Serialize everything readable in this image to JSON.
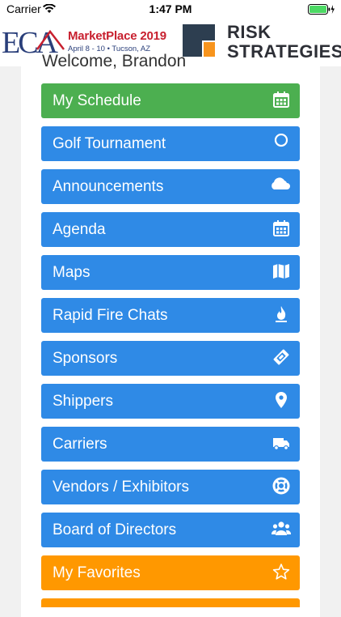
{
  "statusbar": {
    "carrier": "Carrier",
    "time": "1:47 PM"
  },
  "banner": {
    "eca_letters": "ECA",
    "event_title": "MarketPlace 2019",
    "event_subtitle": "April 8 - 10  •  Tucson, AZ",
    "sponsor_line1": "RISK",
    "sponsor_line2": "STRATEGIES"
  },
  "welcome": "Welcome, Brandon",
  "colors": {
    "green": "#4caf50",
    "blue": "#2f8ae6",
    "orange": "#ff9800"
  },
  "menu": [
    {
      "label": "My Schedule",
      "icon": "calendar-check-icon",
      "color": "green"
    },
    {
      "label": "Golf Tournament",
      "icon": "circle-icon",
      "color": "blue"
    },
    {
      "label": "Announcements",
      "icon": "cloud-icon",
      "color": "blue"
    },
    {
      "label": "Agenda",
      "icon": "calendar-icon",
      "color": "blue"
    },
    {
      "label": "Maps",
      "icon": "map-icon",
      "color": "blue"
    },
    {
      "label": "Rapid Fire Chats",
      "icon": "fire-icon",
      "color": "blue"
    },
    {
      "label": "Sponsors",
      "icon": "ticket-icon",
      "color": "blue"
    },
    {
      "label": "Shippers",
      "icon": "map-marker-icon",
      "color": "blue"
    },
    {
      "label": "Carriers",
      "icon": "truck-icon",
      "color": "blue"
    },
    {
      "label": "Vendors / Exhibitors",
      "icon": "life-ring-icon",
      "color": "blue"
    },
    {
      "label": "Board of Directors",
      "icon": "users-icon",
      "color": "blue"
    },
    {
      "label": "My Favorites",
      "icon": "star-icon",
      "color": "orange"
    },
    {
      "label": "",
      "icon": "gear-icon",
      "color": "orange"
    }
  ]
}
